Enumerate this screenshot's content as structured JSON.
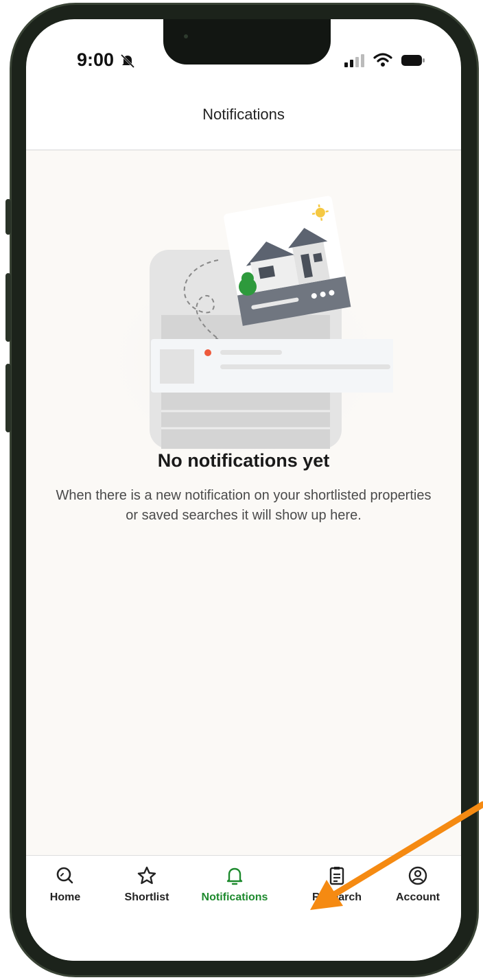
{
  "status_bar": {
    "time": "9:00"
  },
  "header": {
    "title": "Notifications"
  },
  "empty_state": {
    "title": "No notifications yet",
    "body": "When there is a new notification on your shortlisted properties or saved searches it will show up here."
  },
  "tabs": [
    {
      "label": "Home",
      "icon": "search-icon",
      "active": false
    },
    {
      "label": "Shortlist",
      "icon": "star-icon",
      "active": false
    },
    {
      "label": "Notifications",
      "icon": "bell-icon",
      "active": true
    },
    {
      "label": "Research",
      "icon": "document-icon",
      "active": false
    },
    {
      "label": "Account",
      "icon": "user-circle-icon",
      "active": false
    }
  ],
  "colors": {
    "accent": "#1e8a2e",
    "annotation_arrow": "#f58a12",
    "background": "#fbf9f6"
  }
}
